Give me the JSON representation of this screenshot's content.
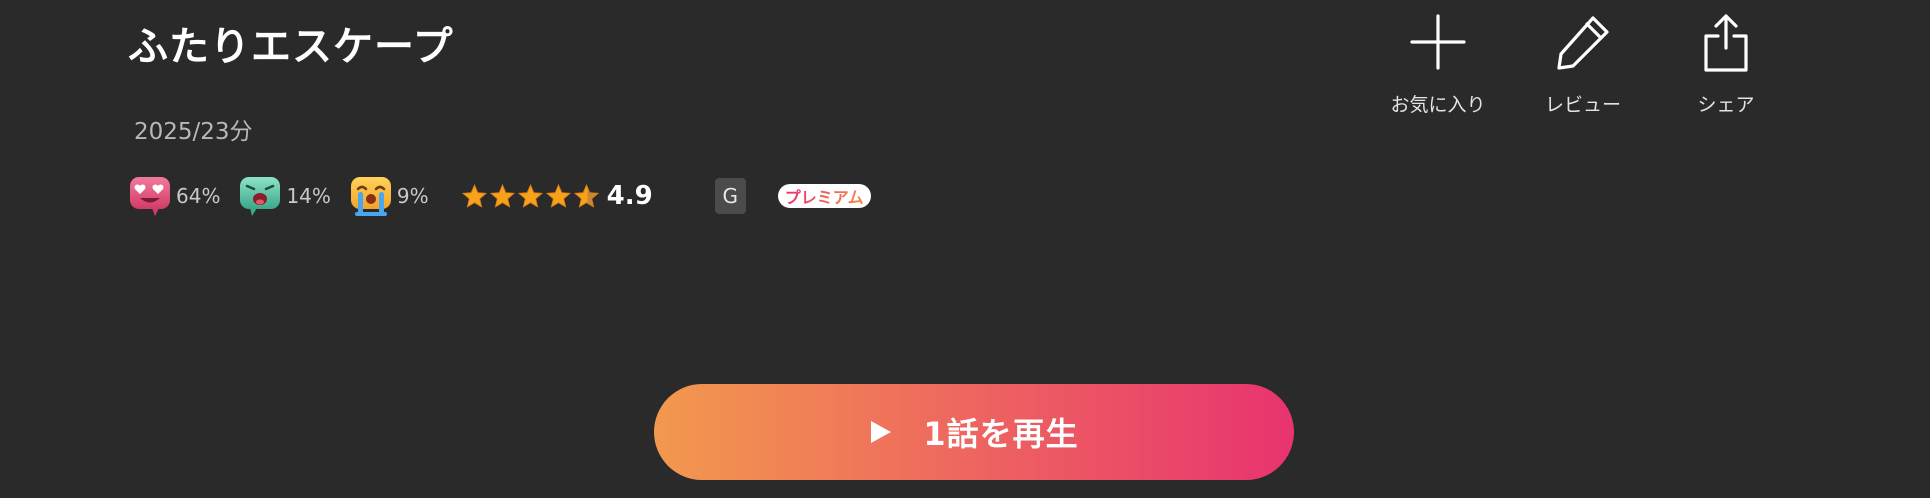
{
  "title": "ふたりエスケープ",
  "meta": "2025/23分",
  "reactions": [
    {
      "icon": "heart-eyes-face-icon",
      "percent": "64%",
      "color": "#e04e7a"
    },
    {
      "icon": "shocked-face-icon",
      "percent": "14%",
      "color": "#3fbf9c"
    },
    {
      "icon": "crying-face-icon",
      "percent": "9%",
      "color": "#f3b233"
    }
  ],
  "rating": {
    "value": "4.9",
    "stars_filled": 4.5,
    "stars_total": 5,
    "star_color": "#f6a21a"
  },
  "age_rating": "G",
  "premium_badge": "プレミアム",
  "actions": [
    {
      "icon": "plus-icon",
      "label": "お気に入り"
    },
    {
      "icon": "pencil-icon",
      "label": "レビュー"
    },
    {
      "icon": "share-icon",
      "label": "シェア"
    }
  ],
  "play_button": {
    "icon": "play-icon",
    "label": "1話を再生",
    "gradient": [
      "#f2994e",
      "#e8336f"
    ]
  },
  "colors": {
    "background": "#2a2a2a",
    "text_primary": "#ffffff",
    "text_secondary": "#b8b8b8"
  }
}
